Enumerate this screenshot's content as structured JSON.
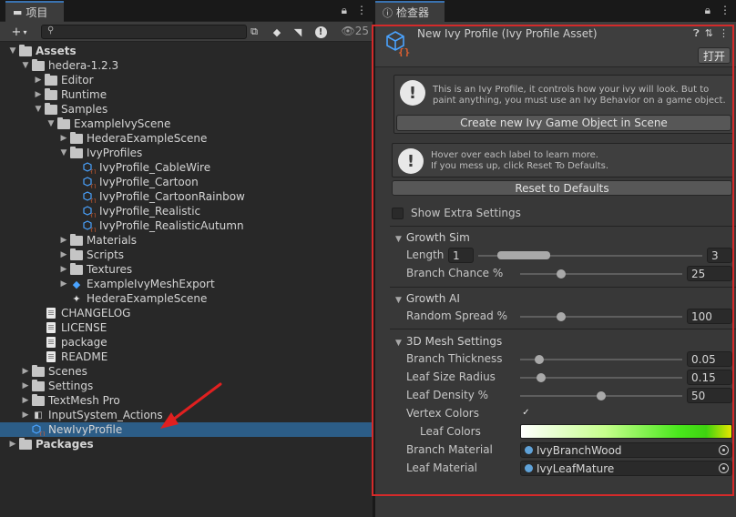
{
  "project_panel": {
    "tab_title": "项目",
    "item_count": "25",
    "tree": [
      {
        "label": "Assets",
        "depth": 0,
        "kind": "folder",
        "expanded": true,
        "bold": true
      },
      {
        "label": "hedera-1.2.3",
        "depth": 1,
        "kind": "folder",
        "expanded": true
      },
      {
        "label": "Editor",
        "depth": 2,
        "kind": "folder",
        "expanded": false
      },
      {
        "label": "Runtime",
        "depth": 2,
        "kind": "folder",
        "expanded": false
      },
      {
        "label": "Samples",
        "depth": 2,
        "kind": "folder",
        "expanded": true
      },
      {
        "label": "ExampleIvyScene",
        "depth": 3,
        "kind": "folder",
        "expanded": true
      },
      {
        "label": "HederaExampleScene",
        "depth": 4,
        "kind": "folder",
        "expanded": false
      },
      {
        "label": "IvyProfiles",
        "depth": 4,
        "kind": "folder",
        "expanded": true
      },
      {
        "label": "IvyProfile_CableWire",
        "depth": 5,
        "kind": "asset"
      },
      {
        "label": "IvyProfile_Cartoon",
        "depth": 5,
        "kind": "asset"
      },
      {
        "label": "IvyProfile_CartoonRainbow",
        "depth": 5,
        "kind": "asset"
      },
      {
        "label": "IvyProfile_Realistic",
        "depth": 5,
        "kind": "asset"
      },
      {
        "label": "IvyProfile_RealisticAutumn",
        "depth": 5,
        "kind": "asset"
      },
      {
        "label": "Materials",
        "depth": 4,
        "kind": "folder",
        "expanded": false
      },
      {
        "label": "Scripts",
        "depth": 4,
        "kind": "folder",
        "expanded": false
      },
      {
        "label": "Textures",
        "depth": 4,
        "kind": "folder",
        "expanded": false
      },
      {
        "label": "ExampleIvyMeshExport",
        "depth": 4,
        "kind": "prefab",
        "expanded": false
      },
      {
        "label": "HederaExampleScene",
        "depth": 4,
        "kind": "scene"
      },
      {
        "label": "CHANGELOG",
        "depth": 2,
        "kind": "doc"
      },
      {
        "label": "LICENSE",
        "depth": 2,
        "kind": "doc"
      },
      {
        "label": "package",
        "depth": 2,
        "kind": "doc"
      },
      {
        "label": "README",
        "depth": 2,
        "kind": "doc"
      },
      {
        "label": "Scenes",
        "depth": 1,
        "kind": "folder",
        "expanded": false
      },
      {
        "label": "Settings",
        "depth": 1,
        "kind": "folder",
        "expanded": false
      },
      {
        "label": "TextMesh Pro",
        "depth": 1,
        "kind": "folder",
        "expanded": false
      },
      {
        "label": "InputSystem_Actions",
        "depth": 1,
        "kind": "input",
        "expanded": false
      },
      {
        "label": "NewIvyProfile",
        "depth": 1,
        "kind": "asset",
        "selected": true
      },
      {
        "label": "Packages",
        "depth": 0,
        "kind": "folder",
        "expanded": false,
        "bold": true
      }
    ]
  },
  "inspector": {
    "tab_title": "检查器",
    "title": "New Ivy Profile (Ivy Profile Asset)",
    "open_button": "打开",
    "help1": "This is an Ivy Profile, it controls how your ivy will look. But to paint anything, you must use an Ivy Behavior on a game object.",
    "create_button": "Create new Ivy Game Object in Scene",
    "help2_line1": "Hover over each label to learn more.",
    "help2_line2": "If you mess up, click Reset To Defaults.",
    "reset_button": "Reset to Defaults",
    "show_extra": {
      "label": "Show Extra Settings",
      "checked": false
    },
    "growth_sim": {
      "title": "Growth Sim",
      "length": {
        "label": "Length",
        "min": "1",
        "max": "3",
        "slider_min": 0.0,
        "slider_max": 1.0
      },
      "branch_chance": {
        "label": "Branch Chance %",
        "value": "25",
        "fraction": 0.25
      }
    },
    "growth_ai": {
      "title": "Growth AI",
      "random_spread": {
        "label": "Random Spread %",
        "value": "100",
        "fraction": 0.25
      }
    },
    "mesh": {
      "title": "3D Mesh Settings",
      "branch_thickness": {
        "label": "Branch Thickness",
        "value": "0.05",
        "fraction": 0.12
      },
      "leaf_size_radius": {
        "label": "Leaf Size Radius",
        "value": "0.15",
        "fraction": 0.13
      },
      "leaf_density": {
        "label": "Leaf Density %",
        "value": "50",
        "fraction": 0.5
      },
      "vertex_colors": {
        "label": "Vertex Colors",
        "checked": true
      },
      "leaf_colors": {
        "label": "Leaf Colors"
      },
      "branch_material": {
        "label": "Branch Material",
        "value": "IvyBranchWood"
      },
      "leaf_material": {
        "label": "Leaf Material",
        "value": "IvyLeafMature"
      }
    }
  },
  "colors": {
    "selection": "#2c5d87",
    "highlight_frame": "#d42a2a",
    "annotation_arrow": "#e02020"
  }
}
